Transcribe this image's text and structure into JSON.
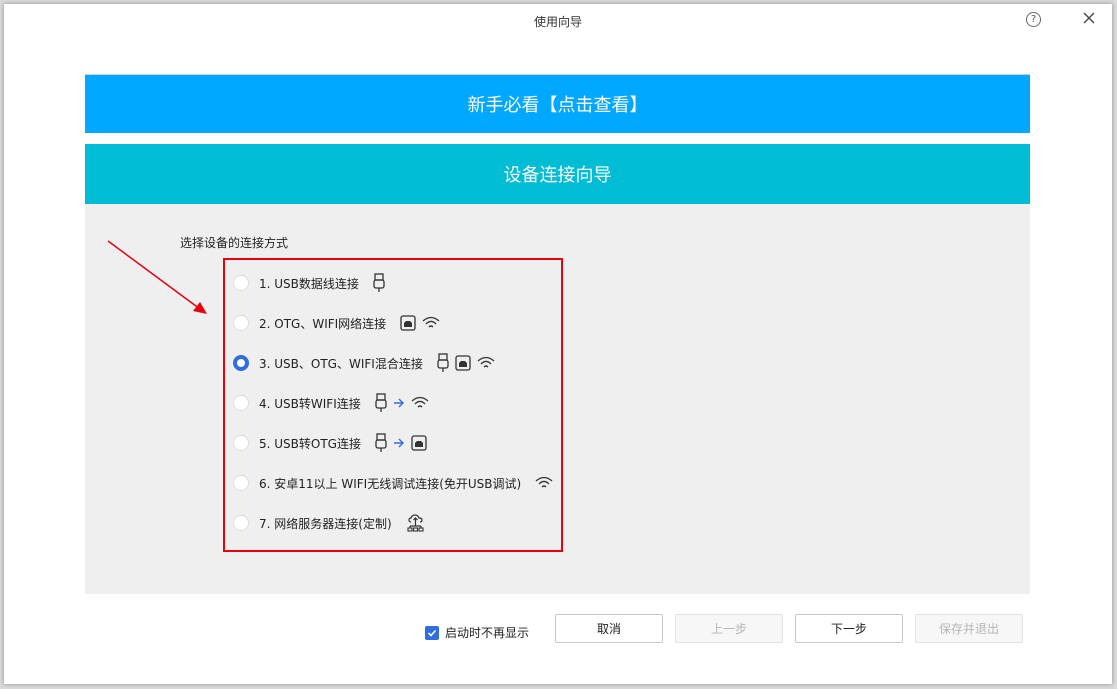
{
  "window": {
    "title": "使用向导"
  },
  "banner": {
    "newbie_label": "新手必看【点击查看】"
  },
  "section": {
    "title": "设备连接向导"
  },
  "prompt": "选择设备的连接方式",
  "options": [
    {
      "label": "1. USB数据线连接",
      "icons": [
        "usb-icon"
      ],
      "selected": false
    },
    {
      "label": "2. OTG、WIFI网络连接",
      "icons": [
        "otg-icon",
        "wifi-icon"
      ],
      "selected": false
    },
    {
      "label": "3. USB、OTG、WIFI混合连接",
      "icons": [
        "usb-icon",
        "otg-icon",
        "wifi-icon"
      ],
      "selected": true
    },
    {
      "label": "4. USB转WIFI连接",
      "icons": [
        "usb-icon",
        "arrow-right-icon",
        "wifi-icon"
      ],
      "selected": false
    },
    {
      "label": "5. USB转OTG连接",
      "icons": [
        "usb-icon",
        "arrow-right-icon",
        "otg-icon"
      ],
      "selected": false
    },
    {
      "label": "6. 安卓11以上 WIFI无线调试连接(免开USB调试)",
      "icons": [
        "wifi-icon"
      ],
      "selected": false
    },
    {
      "label": "7. 网络服务器连接(定制)",
      "icons": [
        "cloud-network-icon"
      ],
      "selected": false
    }
  ],
  "footer": {
    "dont_show_label": "启动时不再显示",
    "dont_show_checked": true,
    "cancel_label": "取消",
    "prev_label": "上一步",
    "next_label": "下一步",
    "save_exit_label": "保存并退出"
  },
  "colors": {
    "banner_blue": "#00a8ff",
    "header_teal": "#00bcd4",
    "accent": "#2f6de0",
    "highlight_red": "#e8000f"
  }
}
